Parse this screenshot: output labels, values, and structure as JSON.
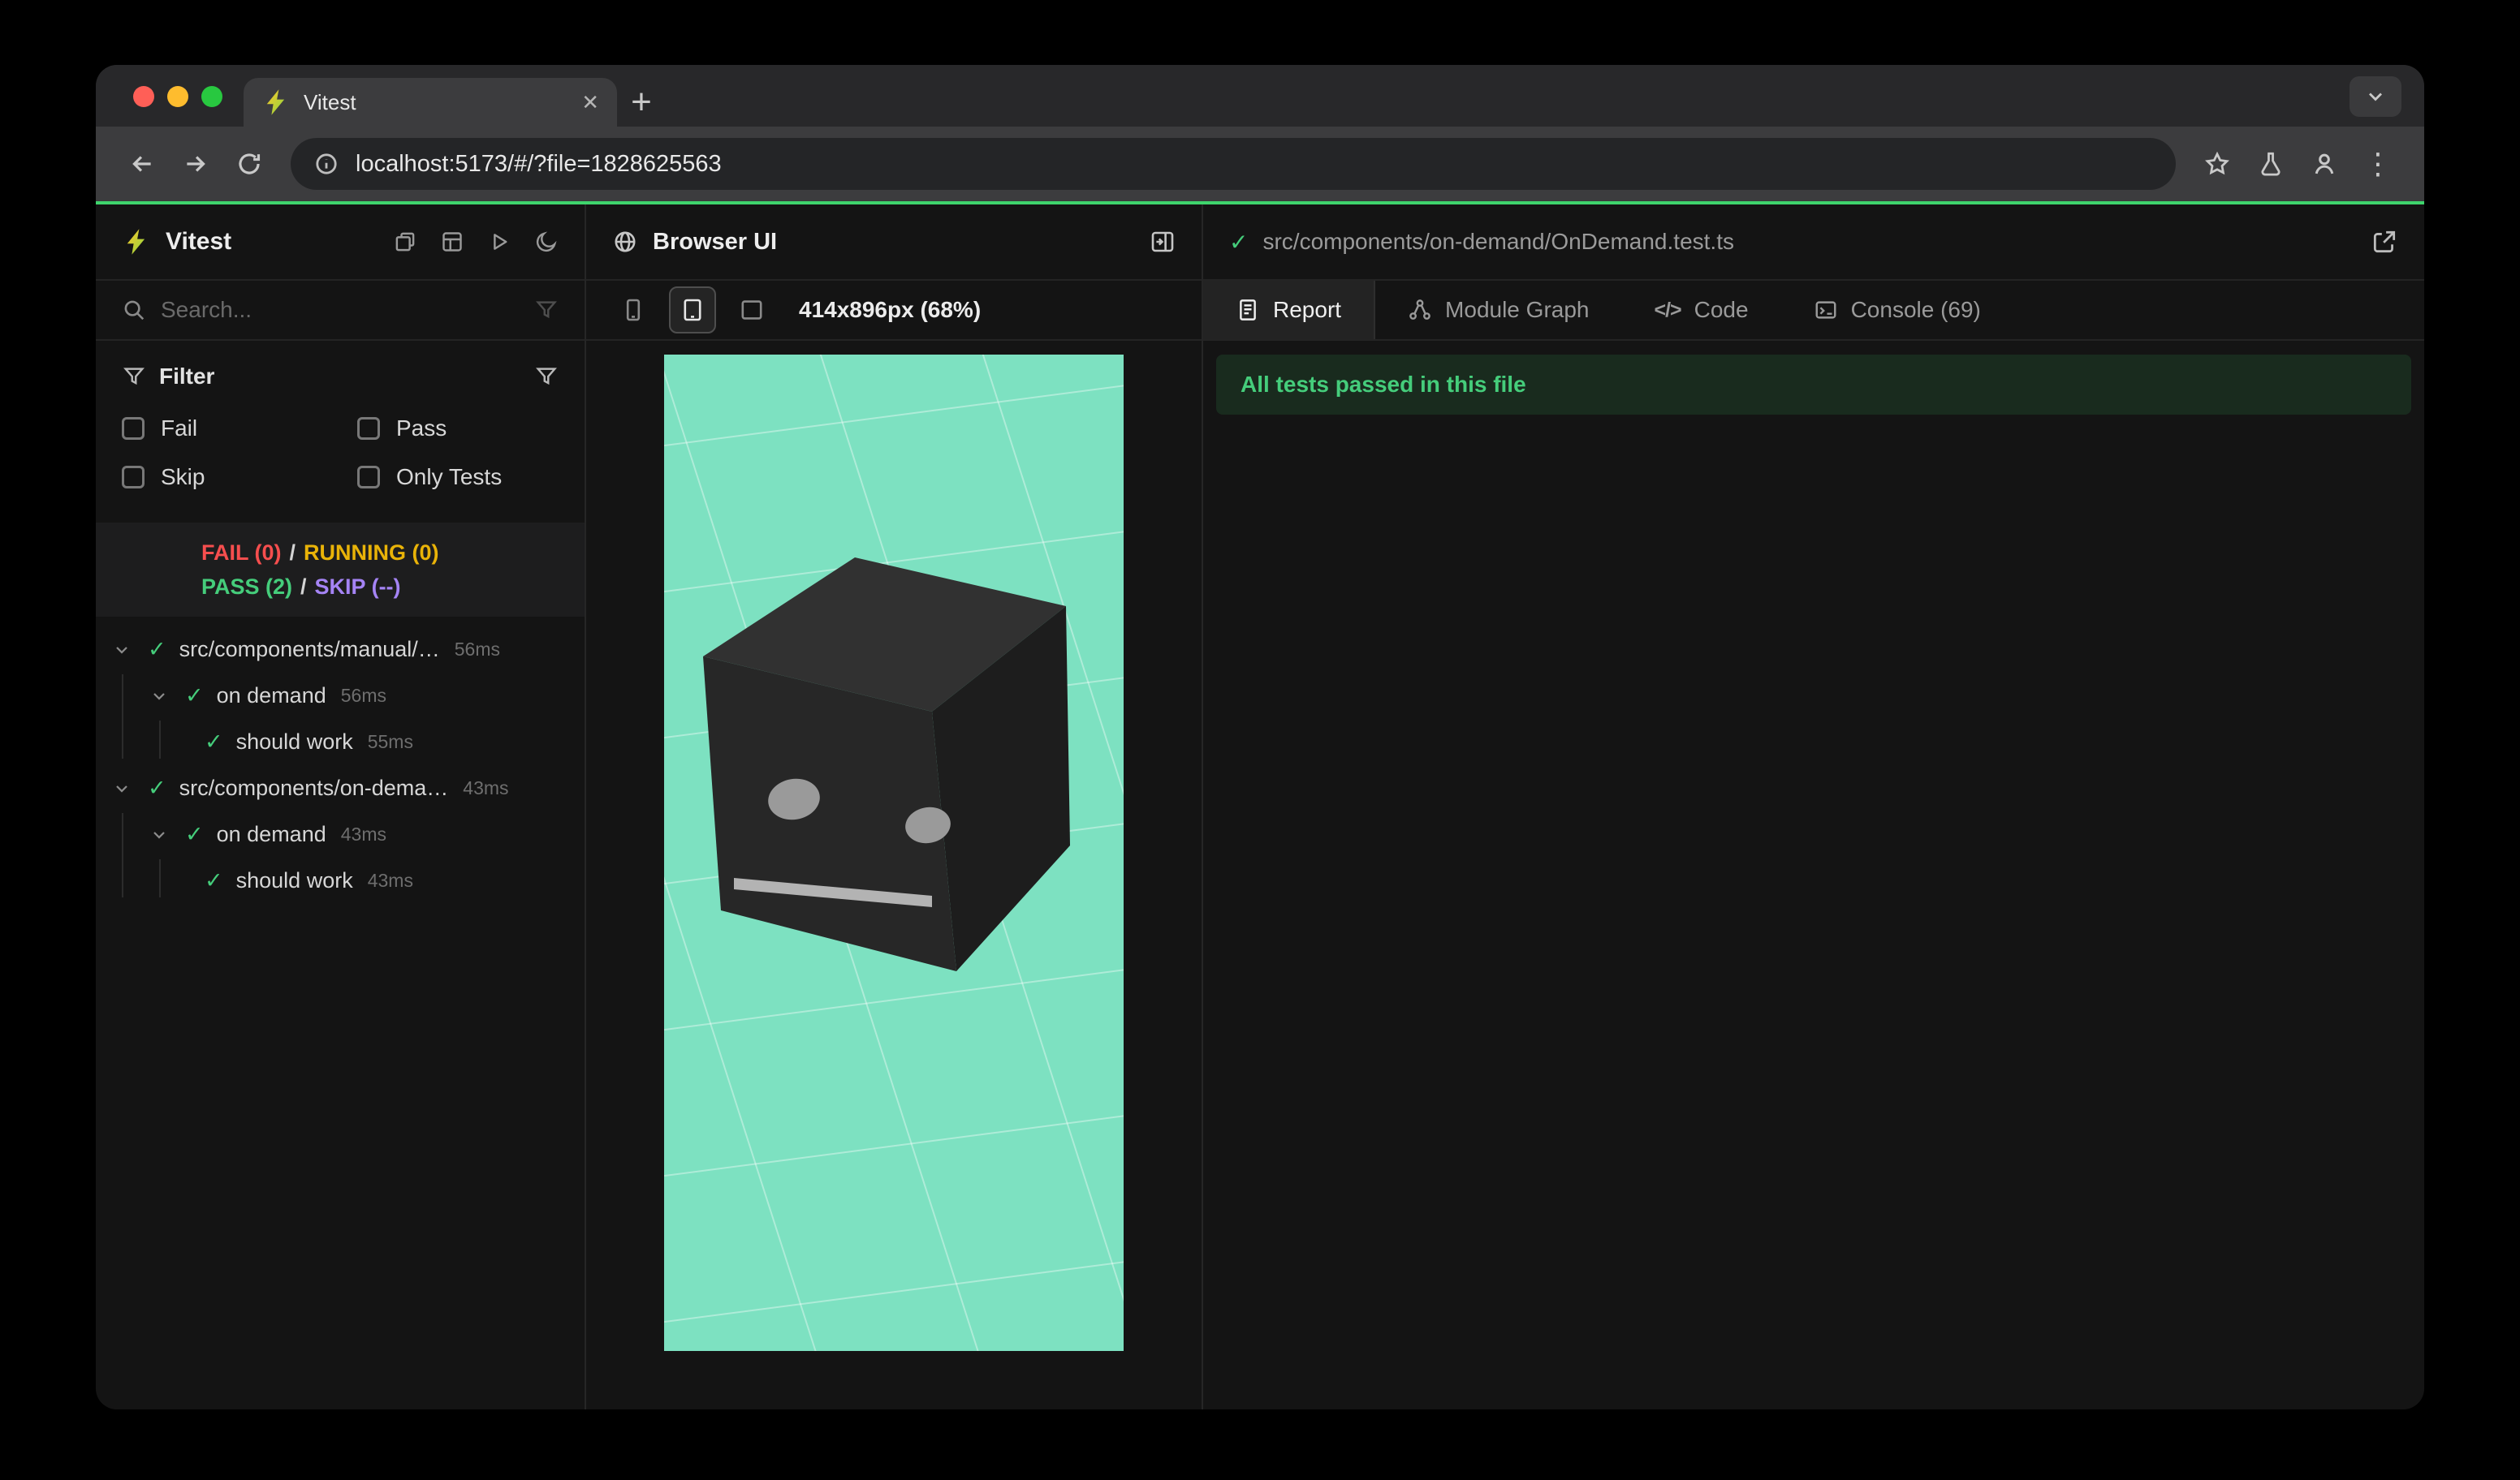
{
  "colors": {
    "accent_green": "#3fd56d",
    "pass_green": "#45cd7b",
    "fail_red": "#f64e4e",
    "running_yellow": "#e9b308",
    "skip_purple": "#a584f5",
    "viewport_teal": "#7de1c1"
  },
  "icons": {
    "check": "✓",
    "close": "✕",
    "new_tab": "+",
    "more": "⋮",
    "code": "</>"
  },
  "browser": {
    "tab_title": "Vitest",
    "url": "localhost:5173/#/?file=1828625563"
  },
  "sidebar": {
    "app_name": "Vitest",
    "search_placeholder": "Search...",
    "filter_title": "Filter",
    "checkboxes": [
      "Fail",
      "Pass",
      "Skip",
      "Only Tests"
    ],
    "summary": {
      "fail": "FAIL (0)",
      "running": "RUNNING (0)",
      "pass": "PASS (2)",
      "skip": "SKIP (--)",
      "sep": "/"
    },
    "tree": [
      {
        "label": "src/components/manual/…",
        "time": "56ms"
      },
      {
        "label": "on demand",
        "time": "56ms"
      },
      {
        "label": "should work",
        "time": "55ms"
      },
      {
        "label": "src/components/on-dema…",
        "time": "43ms"
      },
      {
        "label": "on demand",
        "time": "43ms"
      },
      {
        "label": "should work",
        "time": "43ms"
      }
    ]
  },
  "browser_panel": {
    "title": "Browser UI",
    "viewport_label": "414x896px (68%)"
  },
  "report_panel": {
    "file_path": "src/components/on-demand/OnDemand.test.ts",
    "tabs": [
      "Report",
      "Module Graph",
      "Code",
      "Console (69)"
    ],
    "banner": "All tests passed in this file"
  }
}
